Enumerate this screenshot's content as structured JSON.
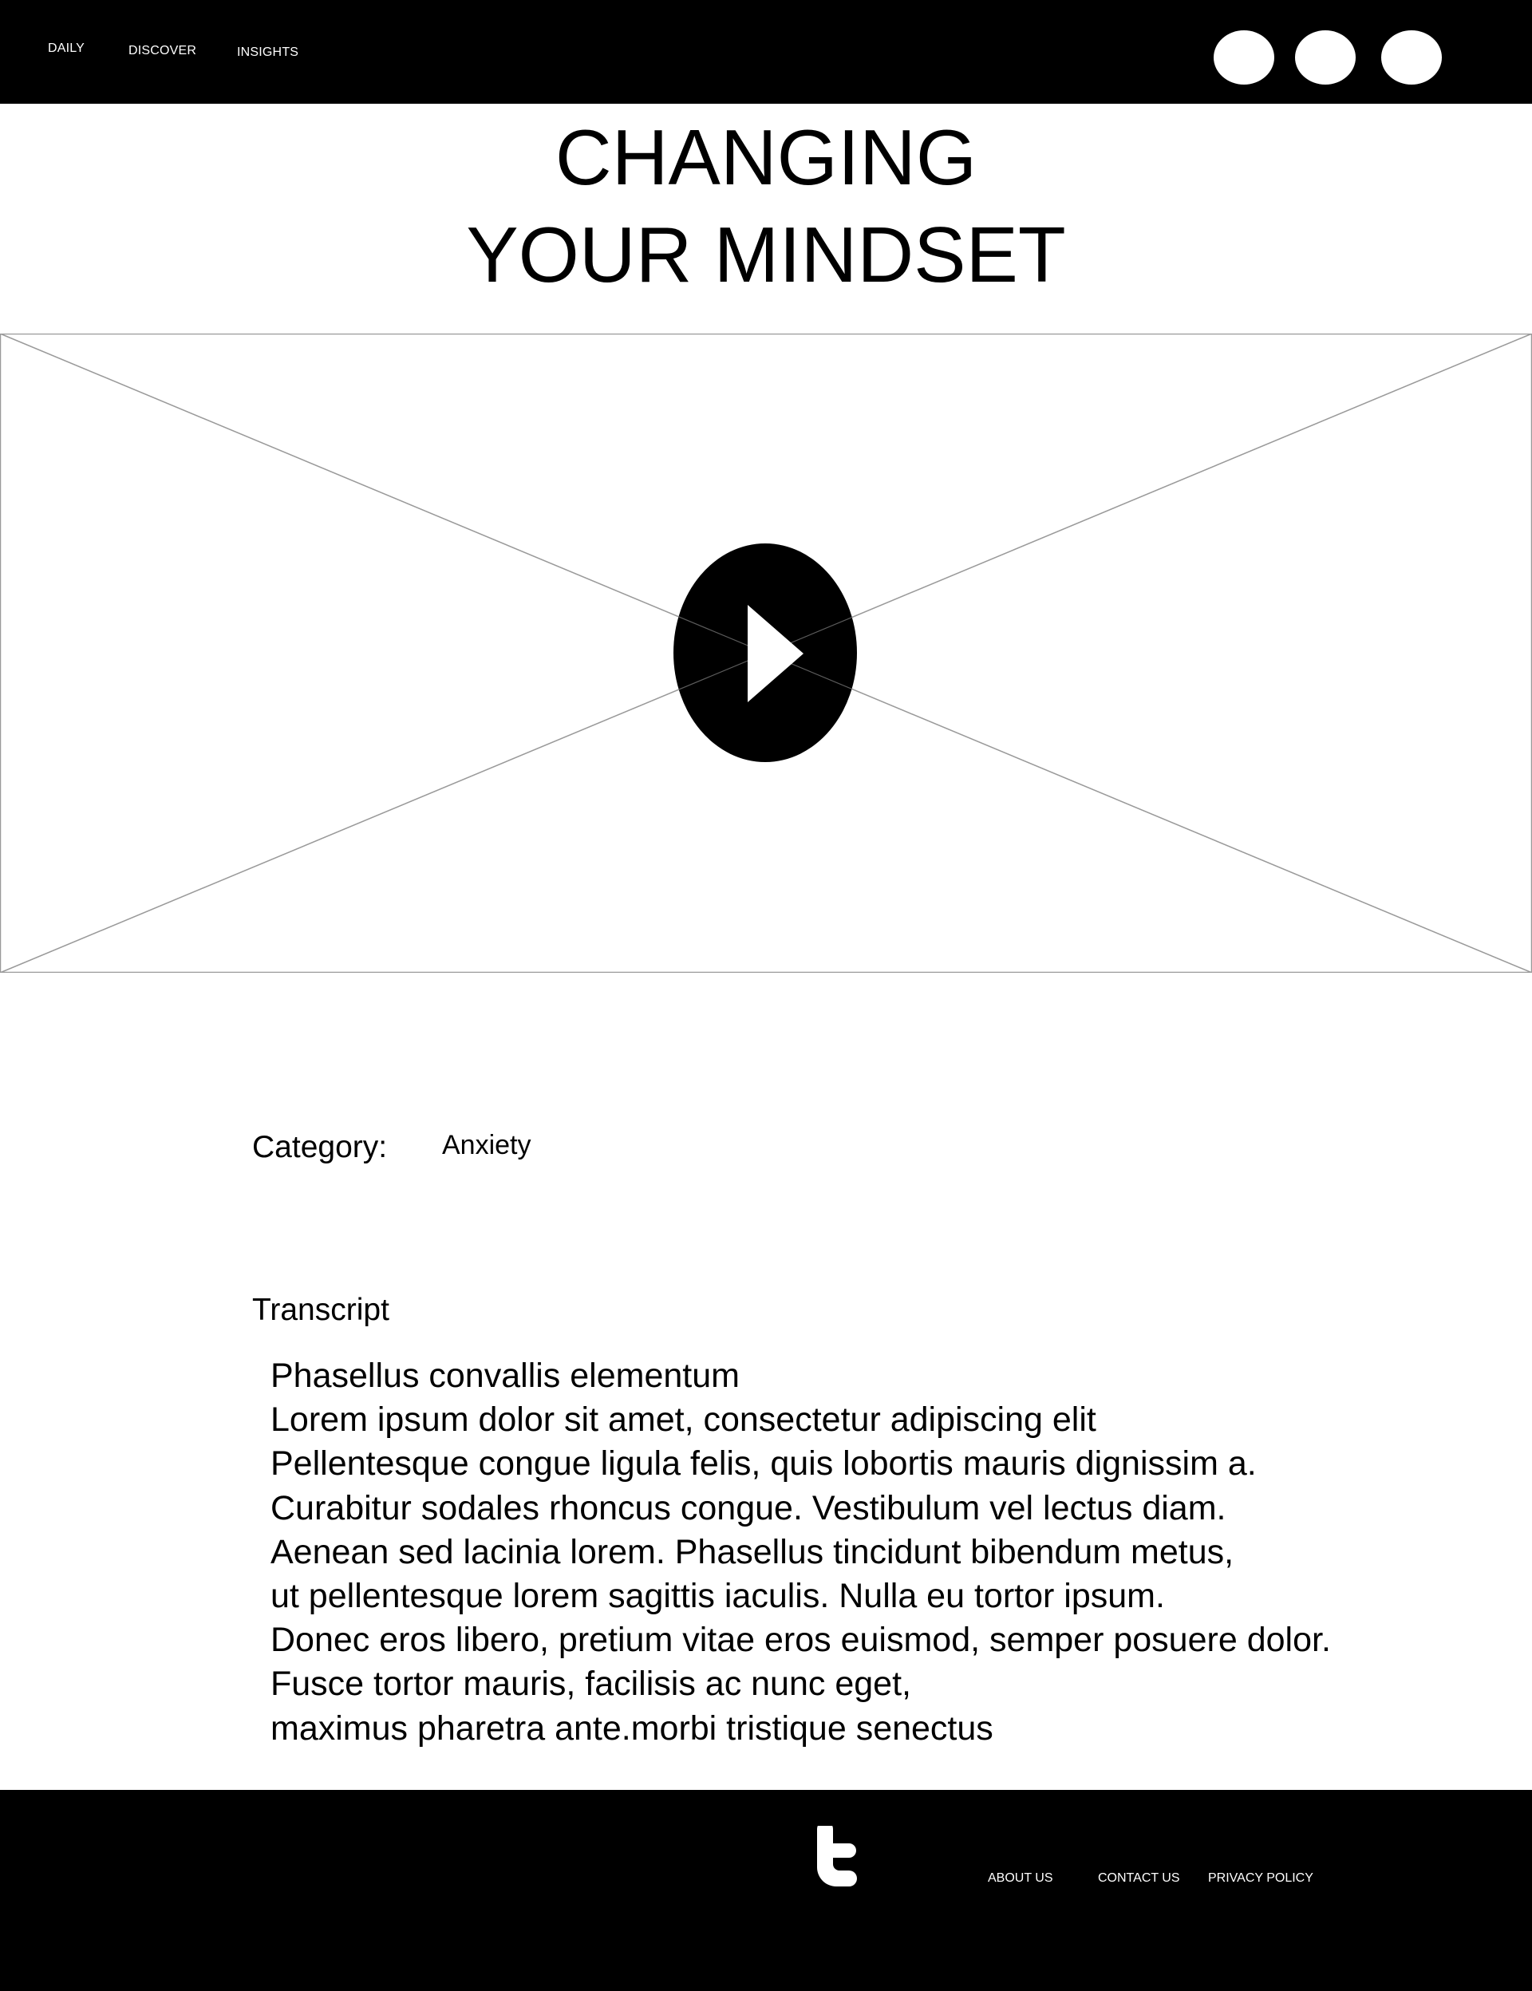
{
  "nav": {
    "items": [
      {
        "label": "DAILY"
      },
      {
        "label": "DISCOVER"
      },
      {
        "label": "INSIGHTS"
      }
    ]
  },
  "header": {
    "action_icons": [
      "circle-icon",
      "circle-icon",
      "circle-icon"
    ]
  },
  "page": {
    "title_line_1": "CHANGING",
    "title_line_2": "YOUR MINDSET"
  },
  "video": {
    "play_icon": "play-icon",
    "placeholder_icon": "image-placeholder-icon"
  },
  "category": {
    "label": "Category:",
    "value": "Anxiety"
  },
  "transcript": {
    "heading": "Transcript",
    "lines": [
      "Phasellus convallis elementum",
      "Lorem ipsum dolor sit amet, consectetur adipiscing elit",
      "Pellentesque congue ligula felis, quis lobortis mauris dignissim a.",
      "Curabitur sodales rhoncus congue. Vestibulum vel lectus diam.",
      "Aenean sed lacinia lorem. Phasellus tincidunt bibendum metus,",
      "ut pellentesque lorem sagittis iaculis. Nulla eu tortor ipsum.",
      "Donec eros libero, pretium vitae eros euismod, semper posuere dolor.",
      "Fusce tortor mauris, facilisis ac nunc eget,",
      "maximus pharetra ante.morbi tristique senectus"
    ]
  },
  "footer": {
    "social_icon": "twitter-icon",
    "links": [
      {
        "label": "ABOUT US"
      },
      {
        "label": "CONTACT US"
      },
      {
        "label": "PRIVACY POLICY"
      }
    ]
  },
  "colors": {
    "header_bg": "#000000",
    "footer_bg": "#000000",
    "text": "#000000",
    "placeholder_lines": "#9a9a9a"
  }
}
